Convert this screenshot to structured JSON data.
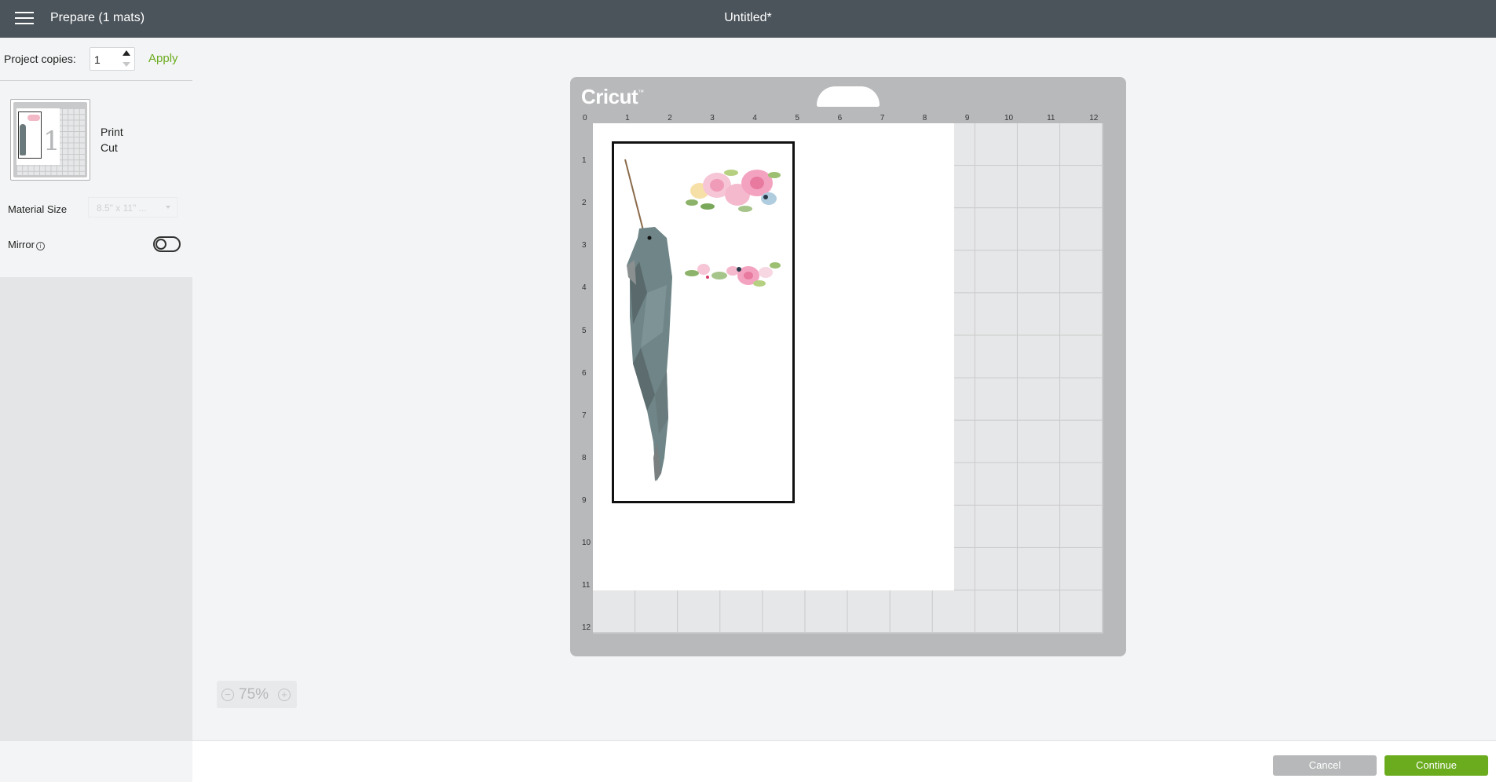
{
  "header": {
    "prepare_label": "Prepare (1 mats)",
    "document_title": "Untitled*"
  },
  "sidebar": {
    "project_copies_label": "Project copies:",
    "project_copies_value": "1",
    "apply_label": "Apply",
    "mat_number": "1",
    "mat_type_line1": "Print",
    "mat_type_line2": "Cut",
    "material_size_label": "Material Size",
    "material_size_value": "8.5\" x 11\" ...",
    "mirror_label": "Mirror",
    "mirror_on": false
  },
  "mat": {
    "brand": "Cricut",
    "ruler_top": [
      "0",
      "1",
      "2",
      "3",
      "4",
      "5",
      "6",
      "7",
      "8",
      "9",
      "10",
      "11",
      "12"
    ],
    "ruler_left": [
      "1",
      "2",
      "3",
      "4",
      "5",
      "6",
      "7",
      "8",
      "9",
      "10",
      "11",
      "12"
    ]
  },
  "zoom": {
    "value": "75%"
  },
  "footer": {
    "cancel_label": "Cancel",
    "continue_label": "Continue"
  },
  "colors": {
    "topbar": "#4b545b",
    "accent_green": "#6bac1f",
    "mat_gray": "#b8b9bb"
  },
  "icons": {
    "menu": "hamburger-icon",
    "info": "info-icon",
    "zoom_out": "minus-circle-icon",
    "zoom_in": "plus-circle-icon"
  }
}
